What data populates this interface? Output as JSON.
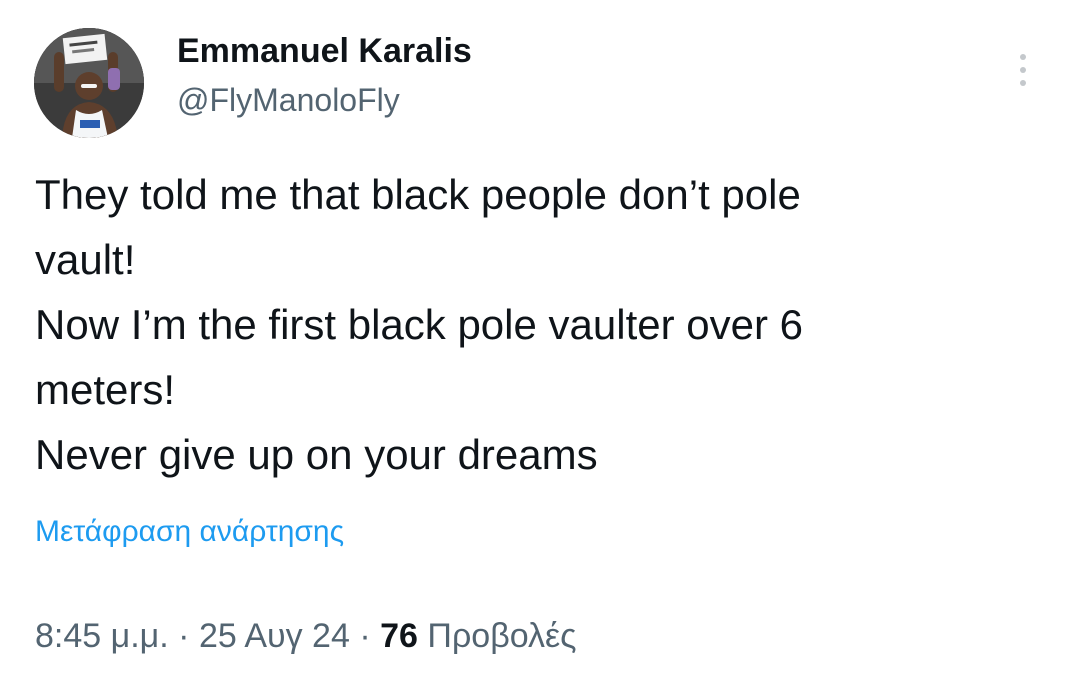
{
  "author": {
    "name": "Emmanuel Karalis",
    "handle": "@FlyManoloFly"
  },
  "tweet": {
    "lines": [
      "They told me that black people don’t pole",
      "vault!",
      "Now I’m the first black pole vaulter over 6",
      "meters!",
      "Never give up on your dreams"
    ],
    "translate_label": "Μετάφραση ανάρτησης"
  },
  "meta": {
    "time": "8:45 μ.μ.",
    "separator": "·",
    "date": "25 Αυγ 24",
    "views_count": "76",
    "views_label": "Προβολές"
  },
  "icons": {
    "more": "more-vertical-icon"
  },
  "colors": {
    "text": "#0f1419",
    "secondary": "#536471",
    "link": "#1d9bf0",
    "background": "#ffffff"
  }
}
